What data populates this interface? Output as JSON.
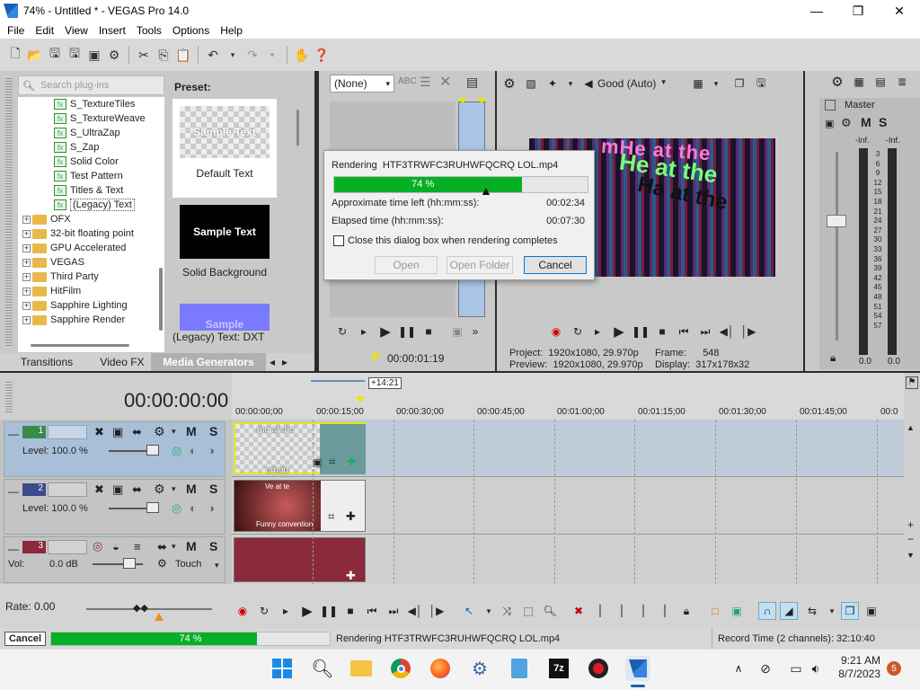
{
  "window": {
    "title": "74% - Untitled * - VEGAS Pro 14.0",
    "controls": [
      "minimize-icon",
      "maximize-icon",
      "close-icon"
    ]
  },
  "menu": [
    "File",
    "Edit",
    "View",
    "Insert",
    "Tools",
    "Options",
    "Help"
  ],
  "explorer": {
    "search_placeholder": "Search plug-ins",
    "items": [
      "S_TextureTiles",
      "S_TextureWeave",
      "S_UltraZap",
      "S_Zap",
      "Solid Color",
      "Test Pattern",
      "Titles & Text",
      "(Legacy) Text"
    ],
    "folders": [
      "OFX",
      "32-bit floating point",
      "GPU Accelerated",
      "VEGAS",
      "Third Party",
      "HitFilm",
      "Sapphire Lighting",
      "Sapphire Render"
    ],
    "preset_label": "Preset:",
    "presets": [
      {
        "thumb": "Sample Text",
        "name": "Default Text"
      },
      {
        "thumb": "Sample Text",
        "name": "Solid Background"
      },
      {
        "thumb": "Sample",
        "name": ""
      }
    ],
    "footer": "(Legacy) Text: DXT",
    "tabs": [
      "Transitions",
      "Video FX",
      "Media Generators"
    ]
  },
  "trimmer": {
    "select_value": "(None)",
    "timecode": "00:00:01:19"
  },
  "preview": {
    "quality": "Good (Auto)",
    "overlay_lines": [
      "mHe at the",
      "He at the",
      "Ha at the"
    ],
    "info": {
      "project_label": "Project:",
      "project_value": "1920x1080, 29.970p",
      "preview_label": "Preview:",
      "preview_value": "1920x1080, 29.970p",
      "frame_label": "Frame:",
      "frame_value": "548",
      "display_label": "Display:",
      "display_value": "317x178x32"
    }
  },
  "master": {
    "title": "Master",
    "mute": "M",
    "solo": "S",
    "inf_left": "-Inf.",
    "inf_right": "-Inf.",
    "scale": [
      "3",
      "6",
      "9",
      "12",
      "15",
      "18",
      "21",
      "24",
      "27",
      "30",
      "33",
      "36",
      "39",
      "42",
      "45",
      "48",
      "51",
      "54",
      "57"
    ],
    "value_left": "0.0",
    "value_right": "0.0"
  },
  "render_dialog": {
    "rendering_label": "Rendering",
    "filename": "HTF3TRWFC3RUHWFQCRQ LOL.mp4",
    "progress_text": "74 %",
    "progress": 0.74,
    "time_left_label": "Approximate time left (hh:mm:ss):",
    "time_left_value": "00:02:34",
    "elapsed_label": "Elapsed time (hh:mm:ss):",
    "elapsed_value": "00:07:30",
    "close_checkbox_label": "Close this dialog box when rendering completes",
    "open_button": "Open",
    "open_folder_button": "Open Folder",
    "cancel_button": "Cancel"
  },
  "timeline": {
    "timecode": "00:00:00:00",
    "loop_marker": "+14:21",
    "ruler": [
      "00:00:00;00",
      "00:00:15;00",
      "00:00:30;00",
      "00:00:45;00",
      "00:01:00;00",
      "00:01:15;00",
      "00:01:30;00",
      "00:01:45;00",
      "00:0"
    ],
    "tracks": [
      {
        "number": "1",
        "level_label": "Level: 100.0 %",
        "clip_text_top": "me at the",
        "clip_text_bottom": "omod"
      },
      {
        "number": "2",
        "level_label": "Level: 100.0 %",
        "clip_text_top": "Ve at te",
        "clip_text_bottom": "Funny convention"
      },
      {
        "number": "3",
        "vol_label": "Vol:",
        "vol_value": "0.0 dB",
        "touch_label": "Touch"
      }
    ],
    "rate_label": "Rate: 0.00"
  },
  "statusbar": {
    "cancel": "Cancel",
    "progress_text": "74 %",
    "progress": 0.74,
    "rendering_text": "Rendering  HTF3TRWFC3RUHWFQCRQ LOL.mp4",
    "record_time": "Record Time (2 channels): 32:10:40"
  },
  "taskbar": {
    "time": "9:21 AM",
    "date": "8/7/2023",
    "notification_count": "5"
  },
  "colors": {
    "progress_green": "#06b025",
    "track1_blue": "#a9bfd8",
    "audio_clip": "#8a2a3a"
  }
}
